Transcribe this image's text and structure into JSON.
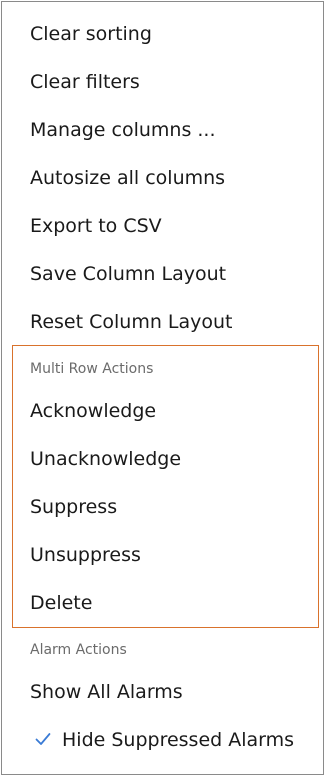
{
  "menu": {
    "items": [
      {
        "label": "Clear sorting"
      },
      {
        "label": "Clear filters"
      },
      {
        "label": "Manage columns ..."
      },
      {
        "label": "Autosize all columns"
      },
      {
        "label": "Export to CSV"
      },
      {
        "label": "Save Column Layout"
      },
      {
        "label": "Reset Column Layout"
      }
    ],
    "multi_row_actions": {
      "header": "Multi Row Actions",
      "items": [
        {
          "label": "Acknowledge"
        },
        {
          "label": "Unacknowledge"
        },
        {
          "label": "Suppress"
        },
        {
          "label": "Unsuppress"
        },
        {
          "label": "Delete"
        }
      ]
    },
    "alarm_actions": {
      "header": "Alarm Actions",
      "items": [
        {
          "label": "Show All Alarms",
          "checked": false
        },
        {
          "label": "Hide Suppressed Alarms",
          "checked": true,
          "icon": "check-icon"
        }
      ]
    }
  },
  "colors": {
    "highlight_border": "#d9722c",
    "check": "#3a7bd5",
    "group_header": "#6b6b6b",
    "text": "#1a1a1a"
  }
}
